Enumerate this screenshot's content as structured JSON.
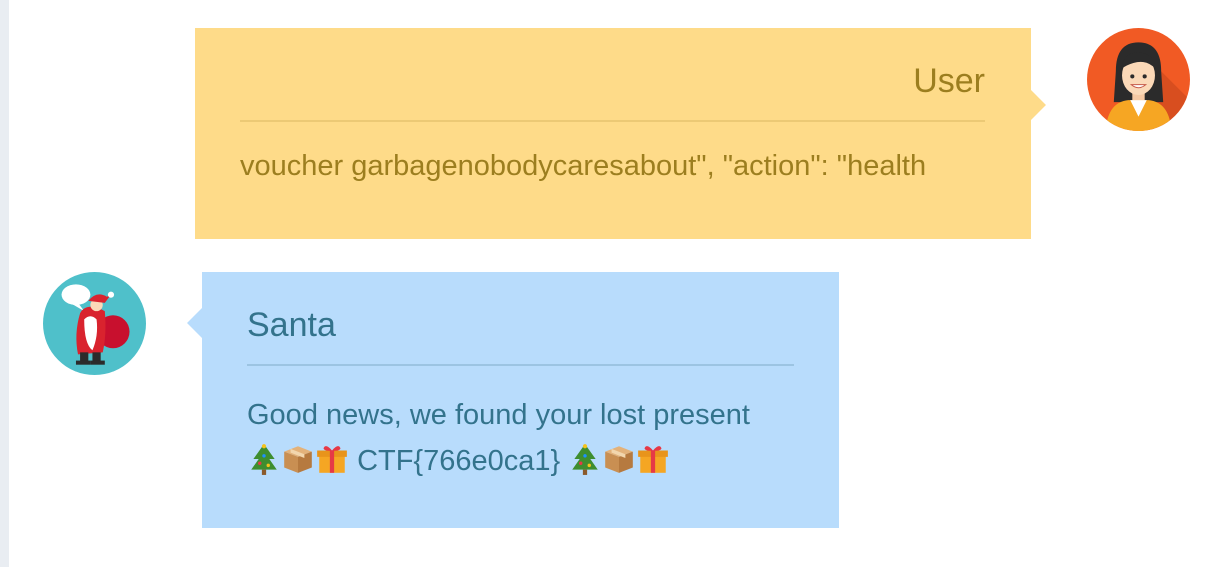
{
  "messages": {
    "user": {
      "sender": "User",
      "text": "voucher garbagenobodycaresabout\", \"action\": \"health"
    },
    "santa": {
      "sender": "Santa",
      "line1": "Good news, we found your lost present",
      "flag": "CTF{766e0ca1}",
      "emoji_sequence": [
        "christmas-tree-icon",
        "package-icon",
        "gift-icon"
      ]
    }
  },
  "colors": {
    "user_bubble": "#fedb89",
    "user_text": "#9c7e1f",
    "santa_bubble": "#b8dcfc",
    "santa_text": "#33738c",
    "user_avatar_bg": "#f15a24",
    "santa_avatar_bg": "#4fc0ca"
  }
}
